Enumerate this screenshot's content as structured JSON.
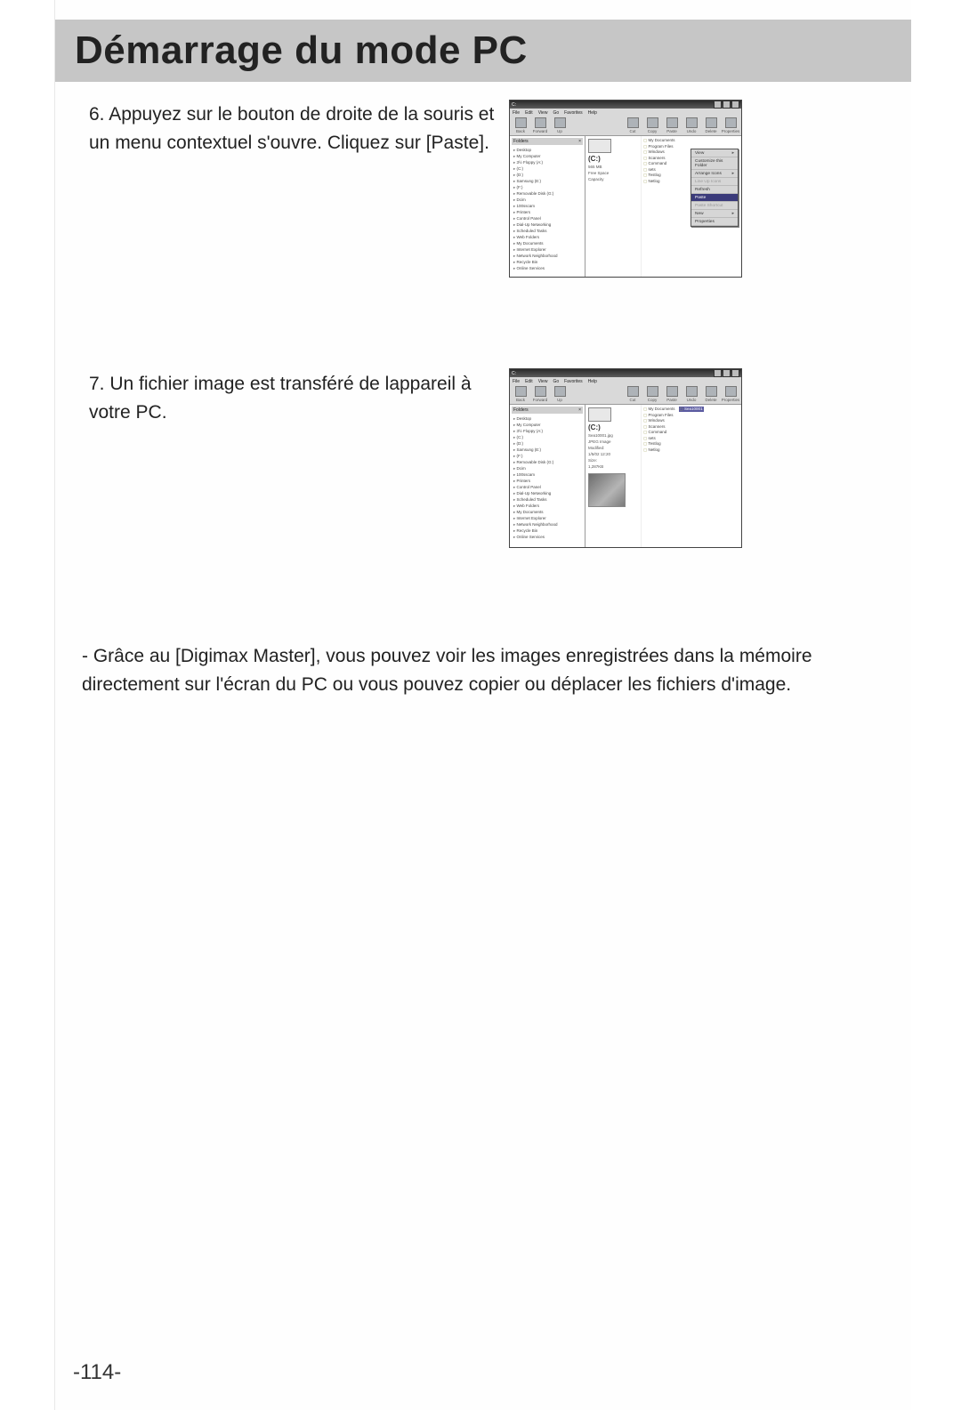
{
  "page": {
    "title": "Démarrage du mode PC",
    "step6": "6. Appuyez sur le bouton de droite de la souris et un menu contextuel s'ouvre. Cliquez sur [Paste].",
    "step7": "7. Un fichier image est transféré de lappareil à votre PC.",
    "note": "- Grâce au [Digimax Master], vous pouvez voir les images enregistrées dans la mémoire directement sur l'écran du PC ou vous pouvez copier ou déplacer les fichiers d'image.",
    "page_number": "-114-"
  },
  "explorer": {
    "titlebar": "C:",
    "menu": [
      "File",
      "Edit",
      "View",
      "Go",
      "Favorites",
      "Help"
    ],
    "toolbar_left": [
      "Back",
      "Forward",
      "Up"
    ],
    "toolbar_right": [
      "Cut",
      "Copy",
      "Paste",
      "Undo",
      "Delete",
      "Properties"
    ],
    "folders_header": "Folders",
    "tree": [
      "Desktop",
      "My Computer",
      "3½ Floppy (A:)",
      "(C:)",
      "(D:)",
      "Samsung (E:)",
      "(F:)",
      "Removable Disk (G:)",
      "Dcim",
      "100sscam",
      "Printers",
      "Control Panel",
      "Dial-Up Networking",
      "Scheduled Tasks",
      "Web Folders",
      "My Documents",
      "Internet Explorer",
      "Network Neighborhood",
      "Recycle Bin",
      "Online Services"
    ],
    "drive_label": "(C:)",
    "drive_info_1": "565 MB",
    "drive_info_2": "Free Space",
    "drive_info_3": "Capacity",
    "files": [
      "My Documents",
      "Program Files",
      "Windows",
      "Scanners",
      "Command",
      "sets",
      "Testlog",
      "Netlog"
    ],
    "context_menu": [
      {
        "label": "View",
        "arrow": true
      },
      {
        "label": "Customize this Folder"
      },
      {
        "label": "Arrange Icons",
        "arrow": true
      },
      {
        "label": "Line Up Icons",
        "disabled": true
      },
      {
        "label": "Refresh"
      },
      {
        "label": "Paste",
        "selected": true
      },
      {
        "label": "Paste Shortcut",
        "disabled": true
      },
      {
        "label": "New",
        "arrow": true
      },
      {
        "label": "Properties"
      }
    ]
  },
  "explorer2": {
    "image_name": "Sea10001.jpg",
    "image_type": "JPEG Image",
    "modified_label": "Modified:",
    "modified_value": "1/5/02 12:20",
    "size_label": "Size:",
    "size_value": "1,287KB",
    "files_col1": [
      "My Documents",
      "Program Files",
      "Windows",
      "Scanners",
      "Command",
      "sets",
      "Testlog",
      "Netlog"
    ],
    "files_col2_selected": "Sea10001"
  }
}
